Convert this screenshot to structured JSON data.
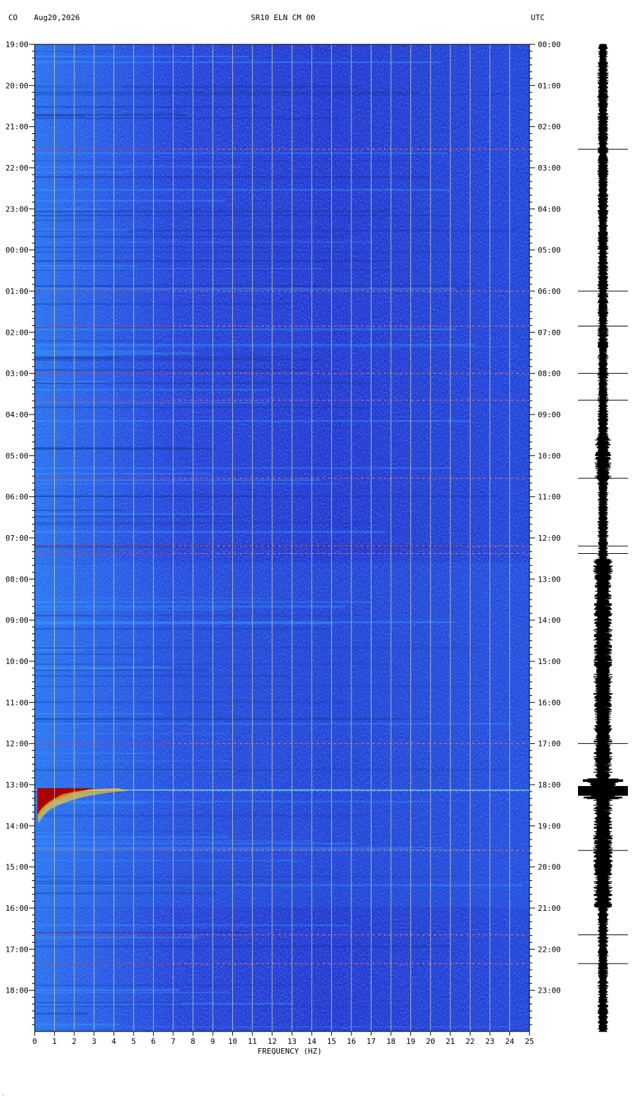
{
  "header": {
    "left_code": "CO",
    "date": "Aug20,2026",
    "station": "SR10 ELN CM 00",
    "tz_right": "UTC"
  },
  "chart_data": {
    "type": "heatmap",
    "title": "SR10 ELN CM 00",
    "xlabel": "FREQUENCY (HZ)",
    "ylabel": "",
    "xlim": [
      0,
      25
    ],
    "x_ticks": [
      "0",
      "1",
      "2",
      "3",
      "4",
      "5",
      "6",
      "7",
      "8",
      "9",
      "10",
      "11",
      "12",
      "13",
      "14",
      "15",
      "16",
      "17",
      "18",
      "19",
      "20",
      "21",
      "22",
      "23",
      "24",
      "25"
    ],
    "y_ticks_left": [
      "19:00",
      "20:00",
      "21:00",
      "22:00",
      "23:00",
      "00:00",
      "01:00",
      "02:00",
      "03:00",
      "04:00",
      "05:00",
      "06:00",
      "07:00",
      "08:00",
      "09:00",
      "10:00",
      "11:00",
      "12:00",
      "13:00",
      "14:00",
      "15:00",
      "16:00",
      "17:00",
      "18:00"
    ],
    "y_ticks_right": [
      "00:00",
      "01:00",
      "02:00",
      "03:00",
      "04:00",
      "05:00",
      "06:00",
      "07:00",
      "08:00",
      "09:00",
      "10:00",
      "11:00",
      "12:00",
      "13:00",
      "14:00",
      "15:00",
      "16:00",
      "17:00",
      "18:00",
      "19:00",
      "20:00",
      "21:00",
      "22:00",
      "23:00"
    ],
    "hours_span": 24,
    "event_hours": [
      2.55,
      6.0,
      6.85,
      8.0,
      8.65,
      10.55,
      12.2,
      12.38,
      17.0,
      18.15,
      19.6,
      21.65,
      22.35
    ],
    "strong_event_hour": 18.1,
    "colors": {
      "background": "#1a2fd0",
      "grid": "#c9c9a0",
      "event": "#ff3030",
      "trace": "#000000"
    },
    "grid": true
  }
}
